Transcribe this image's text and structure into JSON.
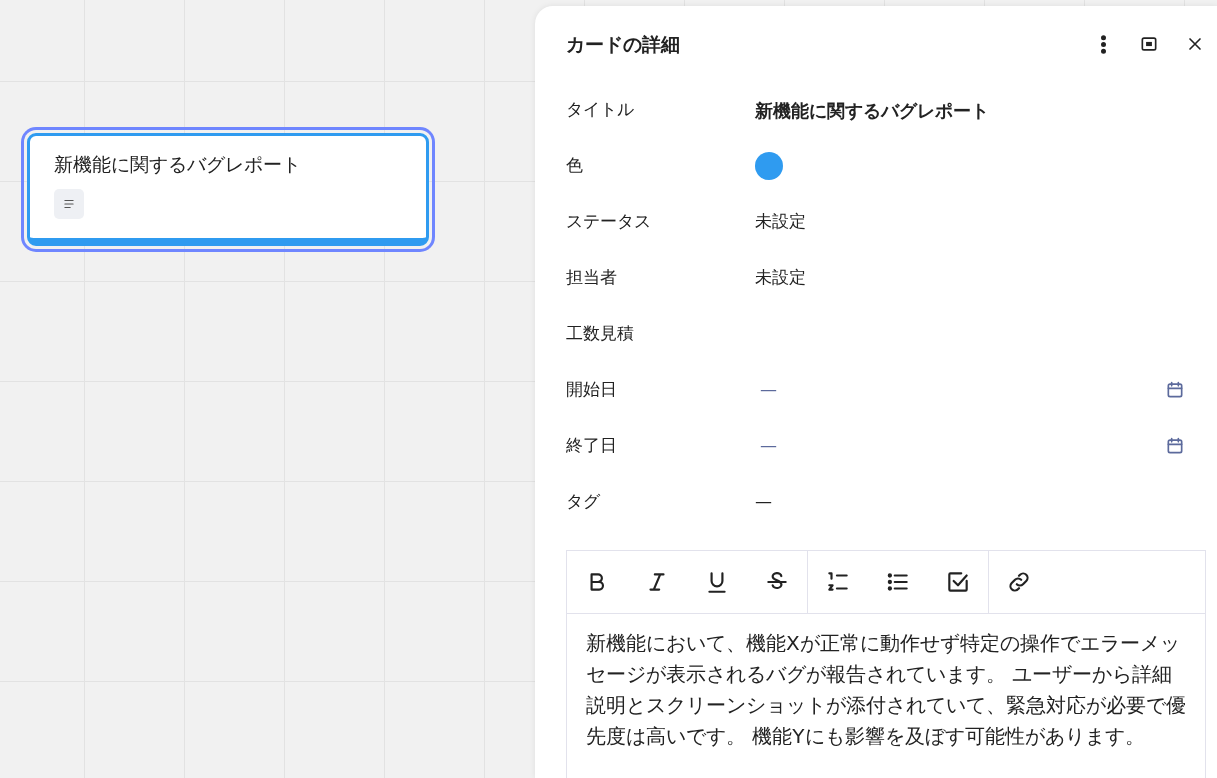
{
  "canvas_card": {
    "title": "新機能に関するバグレポート",
    "color": "#2f9bf0",
    "selected": true,
    "has_description": true
  },
  "panel": {
    "title": "カードの詳細",
    "fields": [
      {
        "kind": "title",
        "label": "タイトル",
        "value": "新機能に関するバグレポート"
      },
      {
        "kind": "color",
        "label": "色",
        "color": "#2f9bf0"
      },
      {
        "kind": "text",
        "label": "ステータス",
        "value": "未設定"
      },
      {
        "kind": "text",
        "label": "担当者",
        "value": "未設定"
      },
      {
        "kind": "empty",
        "label": "工数見積"
      },
      {
        "kind": "date",
        "label": "開始日",
        "value": "—"
      },
      {
        "kind": "date",
        "label": "終了日",
        "value": "—"
      },
      {
        "kind": "text",
        "label": "タグ",
        "value": "—"
      }
    ],
    "description": "新機能において、機能Xが正常に動作せず特定の操作でエラーメッセージが表示されるバグが報告されています。 ユーザーから詳細説明とスクリーンショットが添付されていて、緊急対応が必要で優先度は高いです。 機能Yにも影響を及ぼす可能性があります。"
  }
}
